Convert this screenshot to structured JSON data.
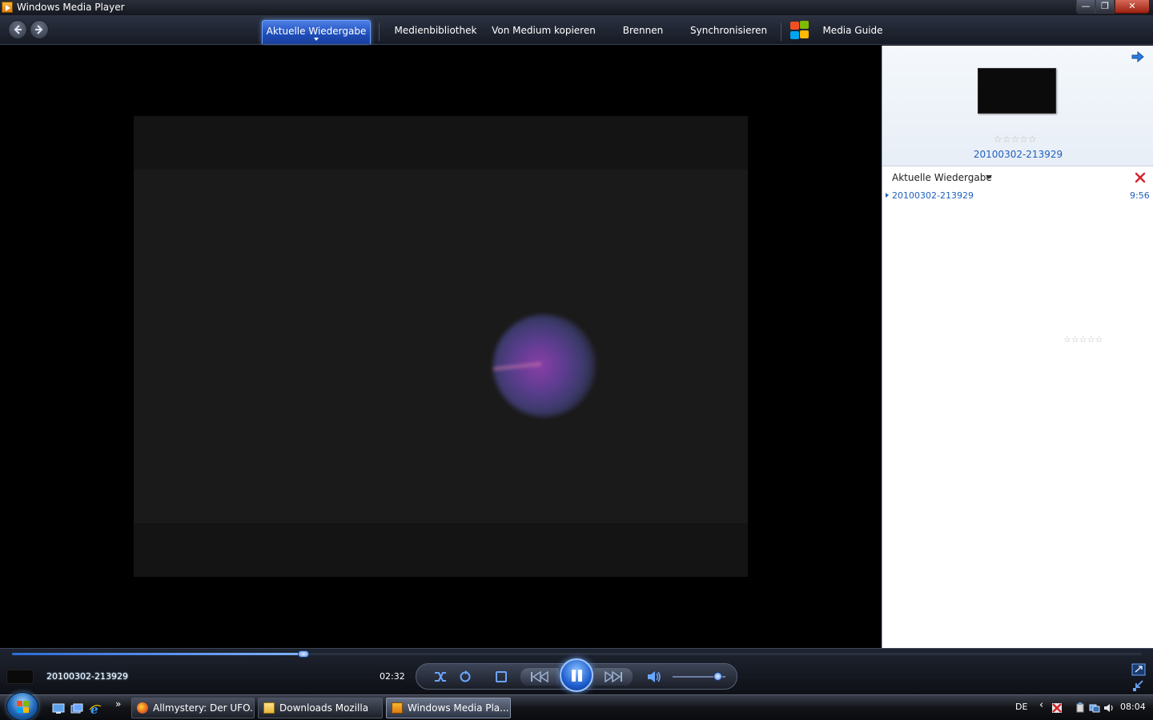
{
  "window": {
    "title": "Windows Media Player",
    "min_glyph": "—",
    "max_glyph": "❐",
    "close_glyph": "✕"
  },
  "toolbar": {
    "tabs": [
      {
        "label": "Aktuelle Wiedergabe",
        "active": true
      },
      {
        "label": "Medienbibliothek"
      },
      {
        "label": "Von Medium kopieren"
      },
      {
        "label": "Brennen"
      },
      {
        "label": "Synchronisieren"
      },
      {
        "label": "Media Guide"
      }
    ]
  },
  "right_pane": {
    "now_playing_title": "20100302-213929",
    "rating_stars": "☆☆☆☆☆",
    "list_label": "Aktuelle Wiedergabe",
    "items": [
      {
        "name": "20100302-213929",
        "duration": "9:56",
        "rating_stars": "☆☆☆☆☆"
      }
    ]
  },
  "transport": {
    "title": "20100302-213929",
    "elapsed": "02:32",
    "seek_fraction": 0.258,
    "volume_fraction": 0.85,
    "state": "playing"
  },
  "taskbar": {
    "more_glyph": "»",
    "tasks": [
      {
        "label": "Allmystery: Der UFO...",
        "icon": "firefox-icon"
      },
      {
        "label": "Downloads Mozilla",
        "icon": "folder-icon"
      },
      {
        "label": "Windows Media Pla...",
        "icon": "wmp-icon",
        "active": true
      }
    ],
    "tray": {
      "language": "DE",
      "expand_glyph": "‹",
      "clock": "08:04"
    }
  },
  "colors": {
    "accent_blue": "#1f5fbf",
    "tab_active": "#2f5fd0",
    "video_bg": "#1a1a1a"
  }
}
